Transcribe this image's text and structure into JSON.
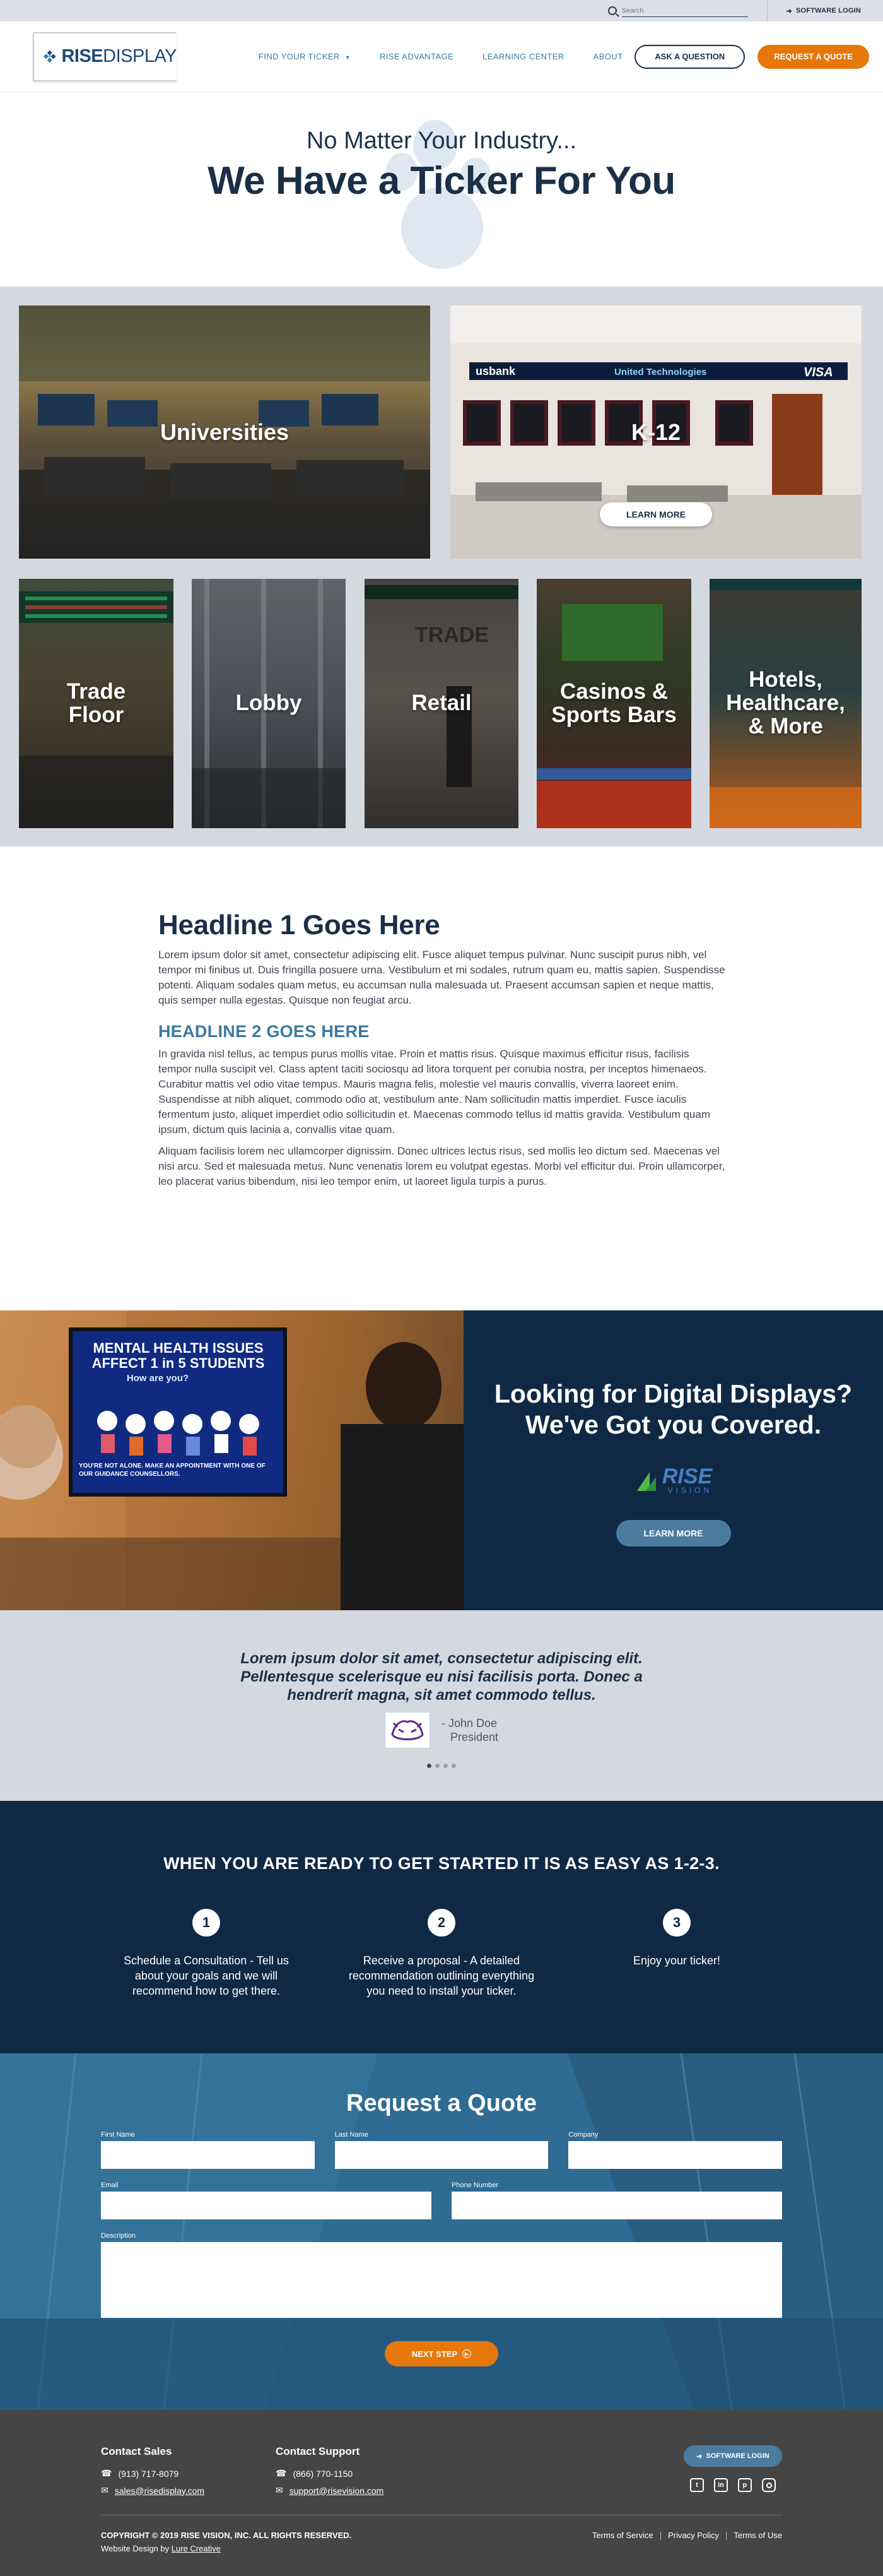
{
  "utility_bar": {
    "search_placeholder": "Search",
    "login_label": "SOFTWARE LOGIN"
  },
  "header": {
    "logo_bold": "RISE",
    "logo_light": "DISPLAY",
    "nav": [
      {
        "label": "FIND YOUR TICKER"
      },
      {
        "label": "RISE ADVANTAGE"
      },
      {
        "label": "LEARNING CENTER"
      },
      {
        "label": "ABOUT"
      }
    ],
    "ask_label": "ASK A QUESTION",
    "quote_label": "REQUEST A QUOTE"
  },
  "hero": {
    "subtitle": "No Matter Your Industry...",
    "title": "We Have a Ticker For You"
  },
  "industries": {
    "large": [
      {
        "label": "Universities"
      },
      {
        "label": "K-12",
        "button": "LEARN MORE"
      }
    ],
    "small": [
      {
        "label": "Trade Floor"
      },
      {
        "label": "Lobby"
      },
      {
        "label": "Retail"
      },
      {
        "label": "Casinos & Sports Bars"
      },
      {
        "label": "Hotels, Healthcare, & More"
      }
    ],
    "k12_signs": {
      "usbank": "usbank",
      "united": "United Technologies",
      "visa": "VISA"
    },
    "retail_sign": "TRADE",
    "colors": {
      "section_bg": "#d4d9e0",
      "accent": "#e6780a",
      "navy": "#1b2f47"
    }
  },
  "content": {
    "headline1": "Headline 1 Goes Here",
    "para1": "Lorem ipsum dolor sit amet, consectetur adipiscing elit. Fusce aliquet tempus pulvinar. Nunc suscipit purus nibh, vel tempor mi finibus ut. Duis fringilla posuere urna. Vestibulum et mi sodales, rutrum quam eu, mattis sapien. Suspendisse potenti. Aliquam sodales quam metus, eu accumsan nulla malesuada ut. Praesent accumsan sapien et neque mattis, quis semper nulla egestas. Quisque non feugiat arcu.",
    "headline2": "HEADLINE 2 GOES HERE",
    "para2": "In gravida nisl tellus, ac tempus purus mollis vitae. Proin et mattis risus. Quisque maximus efficitur risus, facilisis tempor nulla suscipit vel. Class aptent taciti sociosqu ad litora torquent per conubia nostra, per inceptos himenaeos. Curabitur mattis vel odio vitae tempus. Mauris magna felis, molestie vel mauris convallis, viverra laoreet enim. Suspendisse at nibh aliquet, commodo odio at, vestibulum ante. Nam sollicitudin mattis imperdiet. Fusce iaculis fermentum justo, aliquet imperdiet odio sollicitudin et. Maecenas commodo tellus id mattis gravida. Vestibulum quam ipsum, dictum quis lacinia a, convallis vitae quam.",
    "para3": "Aliquam facilisis lorem nec ullamcorper dignissim. Donec ultrices lectus risus, sed mollis leo dictum sed. Maecenas vel nisi arcu. Sed et malesuada metus. Nunc venenatis lorem eu volutpat egestas. Morbi vel efficitur dui. Proin ullamcorper, leo placerat varius bibendum, nisi leo tempor enim, ut laoreet ligula turpis a purus."
  },
  "promo": {
    "screen_title": "MENTAL HEALTH ISSUES AFFECT 1 in 5 STUDENTS",
    "screen_bubble": "How are you?",
    "screen_footer": "YOU'RE NOT ALONE. MAKE AN APPOINTMENT WITH ONE OF OUR GUIDANCE COUNSELLORS.",
    "title": "Looking for Digital Displays? We've Got you Covered.",
    "logo_word": "RISE",
    "logo_sub": "VISION",
    "button": "LEARN MORE"
  },
  "testimonial": {
    "quote": "Lorem ipsum dolor sit amet, consectetur adipiscing elit. Pellentesque scelerisque eu nisi facilisis porta. Donec a hendrerit magna, sit amet commodo tellus.",
    "author": "- John Doe",
    "role": "President"
  },
  "steps": {
    "title": "WHEN YOU ARE READY TO GET STARTED IT IS AS EASY AS 1-2-3.",
    "items": [
      {
        "num": "1",
        "text": "Schedule a Consultation - Tell us about your goals and we will recommend how to get there."
      },
      {
        "num": "2",
        "text": "Receive a proposal - A detailed recommendation outlining everything you need to install your ticker."
      },
      {
        "num": "3",
        "text": "Enjoy your ticker!"
      }
    ]
  },
  "quote_form": {
    "title": "Request a Quote",
    "first_name": "First Name",
    "last_name": "Last Name",
    "company": "Company",
    "email": "Email",
    "phone": "Phone Number",
    "description": "Description",
    "next": "NEXT STEP"
  },
  "footer": {
    "sales_heading": "Contact Sales",
    "sales_phone": "(913) 717-8079",
    "sales_email": "sales@risedisplay.com",
    "support_heading": "Contact Support",
    "support_phone": "(866) 770-1150",
    "support_email": "support@risevision.com",
    "login_label": "SOFTWARE LOGIN",
    "copyright": "COPYRIGHT © 2019 RISE VISION, INC. ALL RIGHTS RESERVED.",
    "design_prefix": "Website Design by ",
    "design_link": "Lure Creative",
    "legal": [
      "Terms of Service",
      "Privacy Policy",
      "Terms of Use"
    ]
  }
}
